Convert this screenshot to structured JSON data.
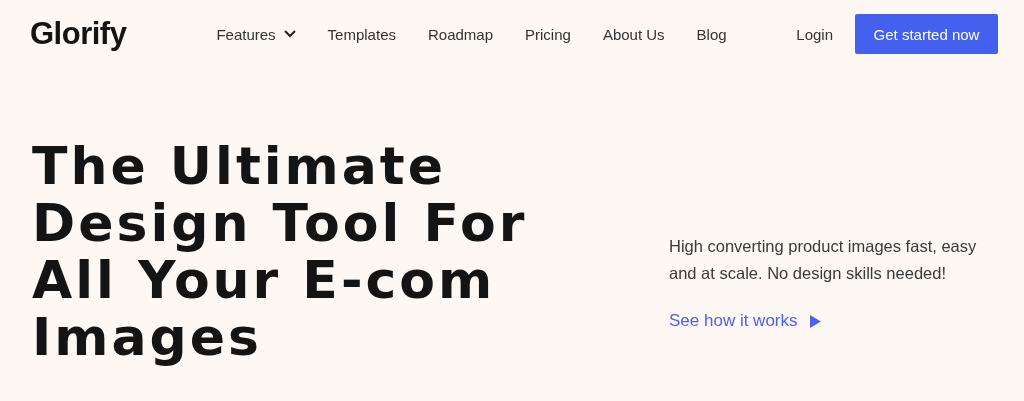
{
  "header": {
    "logo": "Glorify",
    "nav": [
      {
        "label": "Features",
        "dropdown": true
      },
      {
        "label": "Templates",
        "dropdown": false
      },
      {
        "label": "Roadmap",
        "dropdown": false
      },
      {
        "label": "Pricing",
        "dropdown": false
      },
      {
        "label": "About Us",
        "dropdown": false
      },
      {
        "label": "Blog",
        "dropdown": false
      }
    ],
    "login": "Login",
    "cta": "Get started now"
  },
  "hero": {
    "headline_lines": [
      "The Ultimate",
      "Design Tool For",
      "All Your E-com",
      "Images"
    ],
    "description": "High converting product images fast, easy and at scale. No design skills needed!",
    "link": "See how it works"
  }
}
